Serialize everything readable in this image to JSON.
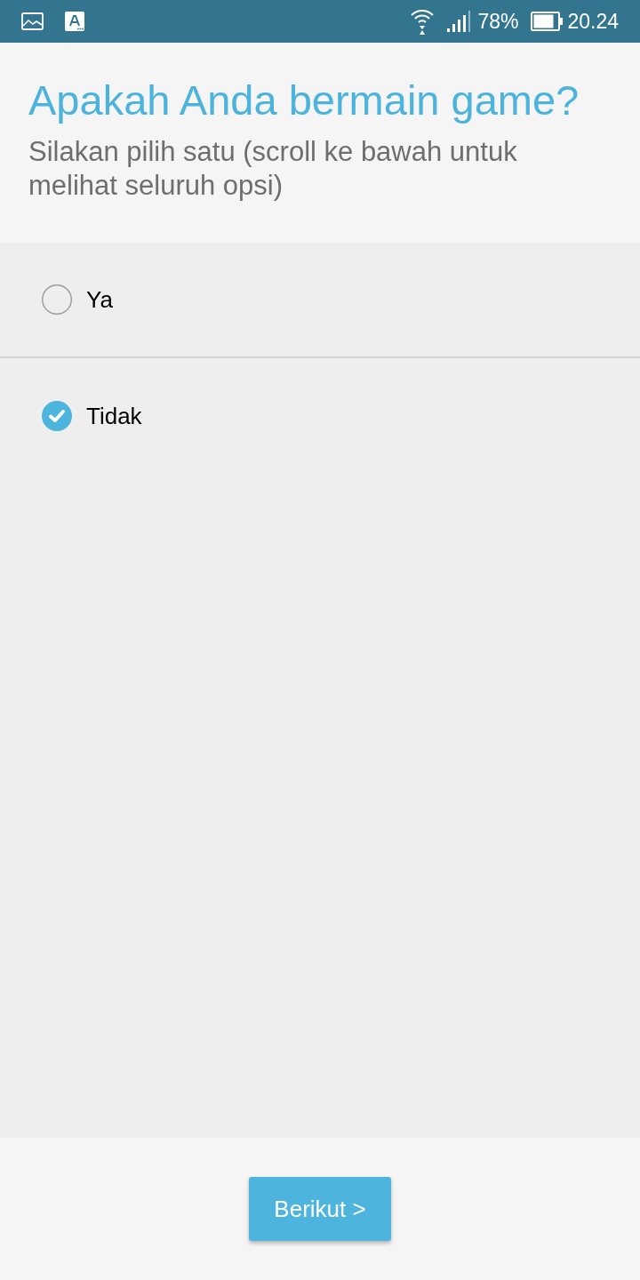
{
  "status_bar": {
    "battery": "78%",
    "time": "20.24"
  },
  "question": {
    "title": "Apakah Anda bermain game?",
    "instruction": "Silakan pilih satu (scroll ke bawah untuk melihat seluruh opsi)"
  },
  "options": [
    {
      "label": "Ya",
      "selected": false
    },
    {
      "label": "Tidak",
      "selected": true
    }
  ],
  "footer": {
    "next_button": "Berikut >"
  }
}
